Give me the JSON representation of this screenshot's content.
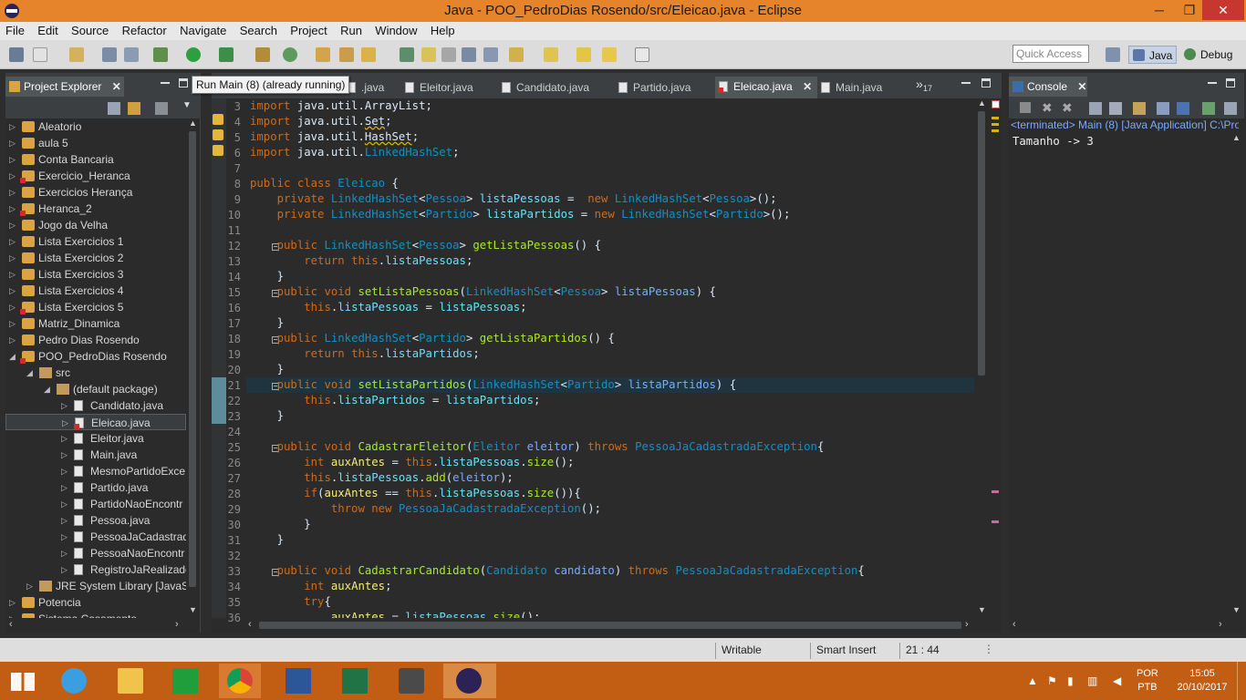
{
  "window": {
    "title": "Java - POO_PedroDias Rosendo/src/Eleicao.java - Eclipse",
    "min_symbol": "─",
    "max_symbol": "❐",
    "close_symbol": "✕"
  },
  "menu": [
    "File",
    "Edit",
    "Source",
    "Refactor",
    "Navigate",
    "Search",
    "Project",
    "Run",
    "Window",
    "Help"
  ],
  "toolbar": {
    "quick_access_placeholder": "Quick Access",
    "perspective_java": "Java",
    "perspective_debug": "Debug"
  },
  "tooltip": "Run Main (8) (already running)",
  "project_explorer": {
    "title": "Project Explorer",
    "close": "✕",
    "tree": [
      {
        "label": "Aleatorio",
        "level": 0,
        "arrow": "▷",
        "icon": "project"
      },
      {
        "label": "aula 5",
        "level": 0,
        "arrow": "▷",
        "icon": "project"
      },
      {
        "label": "Conta Bancaria",
        "level": 0,
        "arrow": "▷",
        "icon": "project"
      },
      {
        "label": "Exercicio_Heranca",
        "level": 0,
        "arrow": "▷",
        "icon": "project-error"
      },
      {
        "label": "Exercicios Herança",
        "level": 0,
        "arrow": "▷",
        "icon": "project"
      },
      {
        "label": "Heranca_2",
        "level": 0,
        "arrow": "▷",
        "icon": "project-error"
      },
      {
        "label": "Jogo da Velha",
        "level": 0,
        "arrow": "▷",
        "icon": "project"
      },
      {
        "label": "Lista Exercicios 1",
        "level": 0,
        "arrow": "▷",
        "icon": "project"
      },
      {
        "label": "Lista Exercicios 2",
        "level": 0,
        "arrow": "▷",
        "icon": "project"
      },
      {
        "label": "Lista Exercicios 3",
        "level": 0,
        "arrow": "▷",
        "icon": "project"
      },
      {
        "label": "Lista Exercicios 4",
        "level": 0,
        "arrow": "▷",
        "icon": "project"
      },
      {
        "label": "Lista Exercicios 5",
        "level": 0,
        "arrow": "▷",
        "icon": "project-error"
      },
      {
        "label": "Matriz_Dinamica",
        "level": 0,
        "arrow": "▷",
        "icon": "project"
      },
      {
        "label": "Pedro Dias Rosendo",
        "level": 0,
        "arrow": "▷",
        "icon": "project"
      },
      {
        "label": "POO_PedroDias Rosendo",
        "level": 0,
        "arrow": "◢",
        "icon": "project-error"
      },
      {
        "label": "src",
        "level": 1,
        "arrow": "◢",
        "icon": "package"
      },
      {
        "label": "(default package)",
        "level": 2,
        "arrow": "◢",
        "icon": "package"
      },
      {
        "label": "Candidato.java",
        "level": 3,
        "arrow": "▷",
        "icon": "file"
      },
      {
        "label": "Eleicao.java",
        "level": 3,
        "arrow": "▷",
        "icon": "file-error",
        "selected": true
      },
      {
        "label": "Eleitor.java",
        "level": 3,
        "arrow": "▷",
        "icon": "file"
      },
      {
        "label": "Main.java",
        "level": 3,
        "arrow": "▷",
        "icon": "file"
      },
      {
        "label": "MesmoPartidoExce",
        "level": 3,
        "arrow": "▷",
        "icon": "file"
      },
      {
        "label": "Partido.java",
        "level": 3,
        "arrow": "▷",
        "icon": "file"
      },
      {
        "label": "PartidoNaoEncontr",
        "level": 3,
        "arrow": "▷",
        "icon": "file"
      },
      {
        "label": "Pessoa.java",
        "level": 3,
        "arrow": "▷",
        "icon": "file"
      },
      {
        "label": "PessoaJaCadastrad",
        "level": 3,
        "arrow": "▷",
        "icon": "file"
      },
      {
        "label": "PessoaNaoEncontr",
        "level": 3,
        "arrow": "▷",
        "icon": "file"
      },
      {
        "label": "RegistroJaRealizado",
        "level": 3,
        "arrow": "▷",
        "icon": "file"
      },
      {
        "label": "JRE System Library [JavaSE",
        "level": 1,
        "arrow": "▷",
        "icon": "library"
      },
      {
        "label": "Potencia",
        "level": 0,
        "arrow": "▷",
        "icon": "project"
      },
      {
        "label": "Sistema Casamento",
        "level": 0,
        "arrow": "▷",
        "icon": "project"
      }
    ]
  },
  "editor": {
    "tabs": [
      {
        "label": ".java",
        "active": false
      },
      {
        "label": "Eleitor.java",
        "active": false
      },
      {
        "label": "Candidato.java",
        "active": false
      },
      {
        "label": "Partido.java",
        "active": false
      },
      {
        "label": "Eleicao.java",
        "active": true
      },
      {
        "label": "Main.java",
        "active": false
      }
    ],
    "overflow_count": "17",
    "overflow_symbol": "»",
    "active_close": "✕",
    "line_numbers": [
      "3",
      "4",
      "5",
      "6",
      "7",
      "8",
      "9",
      "10",
      "11",
      "12",
      "13",
      "14",
      "15",
      "16",
      "17",
      "18",
      "19",
      "20",
      "21",
      "22",
      "23",
      "24",
      "25",
      "26",
      "27",
      "28",
      "29",
      "30",
      "31",
      "32",
      "33",
      "34",
      "35",
      "36"
    ],
    "lines": [
      "import java.util.ArrayList;",
      "import java.util.Set;",
      "import java.util.HashSet;",
      "import java.util.LinkedHashSet;",
      "",
      "public class Eleicao {",
      "    private LinkedHashSet<Pessoa> listaPessoas =  new LinkedHashSet<Pessoa>();",
      "    private LinkedHashSet<Partido> listaPartidos = new LinkedHashSet<Partido>();",
      "",
      "    public LinkedHashSet<Pessoa> getListaPessoas() {",
      "        return this.listaPessoas;",
      "    }",
      "    public void setListaPessoas(LinkedHashSet<Pessoa> listaPessoas) {",
      "        this.listaPessoas = listaPessoas;",
      "    }",
      "    public LinkedHashSet<Partido> getListaPartidos() {",
      "        return this.listaPartidos;",
      "    }",
      "    public void setListaPartidos(LinkedHashSet<Partido> listaPartidos) {",
      "        this.listaPartidos = listaPartidos;",
      "    }",
      "",
      "    public void CadastrarEleitor(Eleitor eleitor) throws PessoaJaCadastradaException{",
      "        int auxAntes = this.listaPessoas.size();",
      "        this.listaPessoas.add(eleitor);",
      "        if(auxAntes == this.listaPessoas.size()){",
      "            throw new PessoaJaCadastradaException();",
      "        }",
      "    }",
      "",
      "    public void CadastrarCandidato(Candidato candidato) throws PessoaJaCadastradaException{",
      "        int auxAntes;",
      "        try{",
      "            auxAntes = listaPessoas.size();"
    ]
  },
  "console": {
    "title": "Console",
    "close": "✕",
    "status": "<terminated> Main (8) [Java Application] C:\\Pro",
    "output": "Tamanho -> 3"
  },
  "statusbar": {
    "writable": "Writable",
    "insert_mode": "Smart Insert",
    "position": "21 : 44"
  },
  "taskbar": {
    "lang_top": "POR",
    "lang_bottom": "PTB",
    "time": "15:05",
    "date": "20/10/2017",
    "apps": [
      "start",
      "internet-explorer",
      "file-explorer",
      "store",
      "chrome",
      "word",
      "excel",
      "sublime",
      "eclipse"
    ]
  },
  "colors": {
    "titlebar": "#e5842b",
    "taskbar": "#c25d14",
    "editor_bg": "#2b2b2b",
    "keyword": "#cc6c1d",
    "type": "#1290c3",
    "field": "#66e1f8",
    "method": "#a7ec21"
  }
}
